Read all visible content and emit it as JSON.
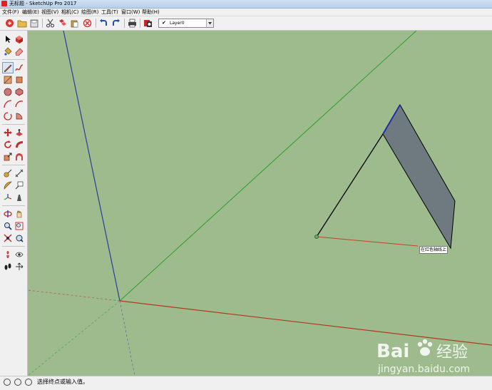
{
  "window": {
    "title": "无标题 - SketchUp Pro 2017"
  },
  "menu": {
    "items": [
      "文件(F)",
      "编辑(E)",
      "视图(V)",
      "相机(C)",
      "绘图(R)",
      "工具(T)",
      "窗口(W)",
      "帮助(H)"
    ]
  },
  "toolbar": {
    "layer": {
      "check": "✔",
      "value": "Layer0"
    }
  },
  "viewport": {
    "background": "#9dbb8d",
    "face_color": "#6e7a80",
    "axis_colors": {
      "red": "#b03a20",
      "green": "#2aa02a",
      "blue": "#2a3e9a"
    },
    "inference_tooltip": "在红色轴线上"
  },
  "statusbar": {
    "hint": "选择终点或输入值。"
  },
  "watermark": {
    "brand": "Bai",
    "brand_cn": "经验",
    "url": "jingyan.baidu.com"
  }
}
